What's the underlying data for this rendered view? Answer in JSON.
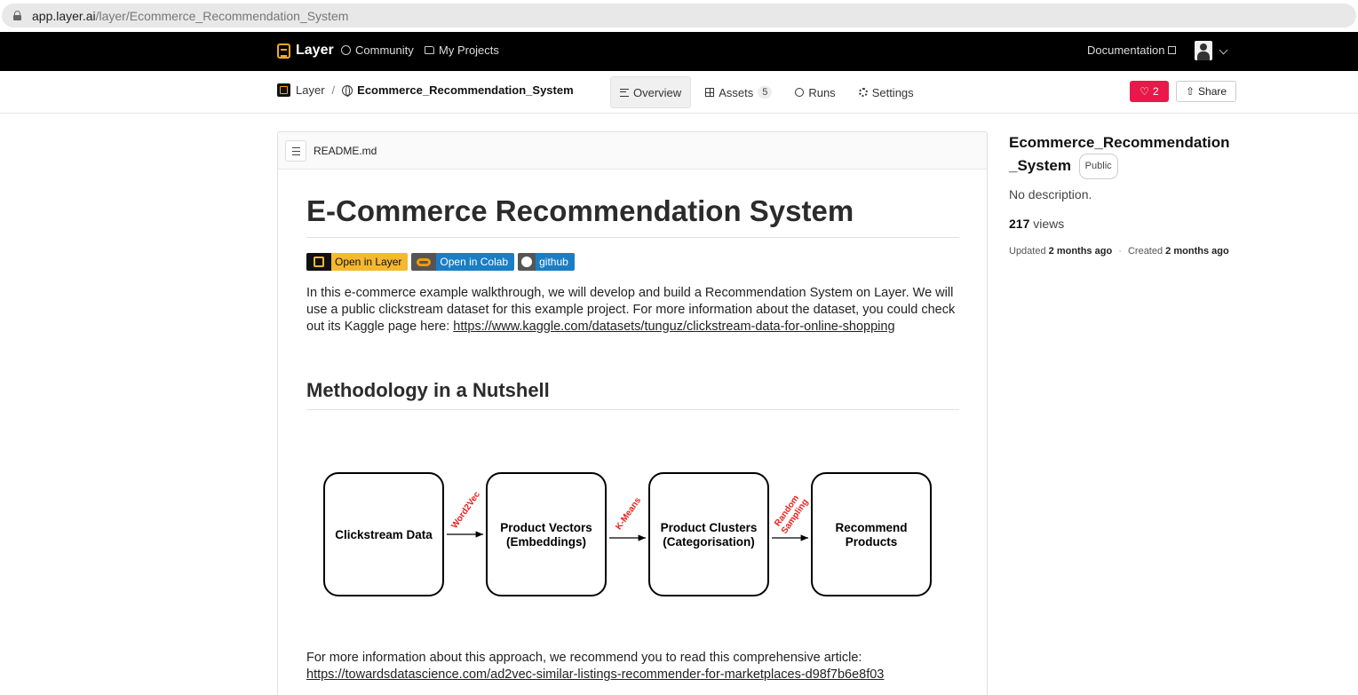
{
  "browser": {
    "url_host": "app.layer.ai",
    "url_path": "/layer/Ecommerce_Recommendation_System"
  },
  "topnav": {
    "brand": "Layer",
    "community": "Community",
    "my_projects": "My Projects",
    "documentation": "Documentation"
  },
  "subnav": {
    "breadcrumb_root": "Layer",
    "breadcrumb_sep": "/",
    "breadcrumb_project": "Ecommerce_Recommendation_System",
    "tabs": [
      {
        "label": "Overview"
      },
      {
        "label": "Assets",
        "count": "5"
      },
      {
        "label": "Runs"
      },
      {
        "label": "Settings"
      }
    ],
    "likes": "2",
    "share": "Share"
  },
  "readme": {
    "filename": "README.md",
    "title": "E-Commerce Recommendation System",
    "badges": {
      "layer": "Open in Layer",
      "colab": "Open in Colab",
      "github": "github"
    },
    "intro": "In this e-commerce example walkthrough, we will develop and build a Recommendation System on Layer. We will use a public clickstream dataset for this example project. For more information about the dataset, you could check out its Kaggle page here: ",
    "intro_link": "https://www.kaggle.com/datasets/tunguz/clickstream-data-for-online-shopping",
    "section_title": "Methodology in a Nutshell",
    "diagram": {
      "boxes": [
        [
          "Clickstream Data"
        ],
        [
          "Product Vectors",
          "(Embeddings)"
        ],
        [
          "Product Clusters",
          "(Categorisation)"
        ],
        [
          "Recommend",
          "Products"
        ]
      ],
      "arrows": [
        [
          "Word2Vec"
        ],
        [
          "K-Means"
        ],
        [
          "Random",
          "Sampling"
        ]
      ],
      "arrow_color": "#e8211c"
    },
    "outro": "For more information about this approach, we recommend you to read this comprehensive article:",
    "outro_link": "https://towardsdatascience.com/ad2vec-similar-listings-recommender-for-marketplaces-d98f7b6e8f03"
  },
  "sidebar": {
    "title_line1": "Ecommerce_Recommendation",
    "title_line2": "_System",
    "visibility": "Public",
    "description": "No description.",
    "views_count": "217",
    "views_label": "views",
    "updated_label": "Updated",
    "updated_value": "2 months ago",
    "created_label": "Created",
    "created_value": "2 months ago"
  },
  "colors": {
    "accent": "#f5a623",
    "like": "#e8194a",
    "badge_blue": "#1a7ec5"
  }
}
